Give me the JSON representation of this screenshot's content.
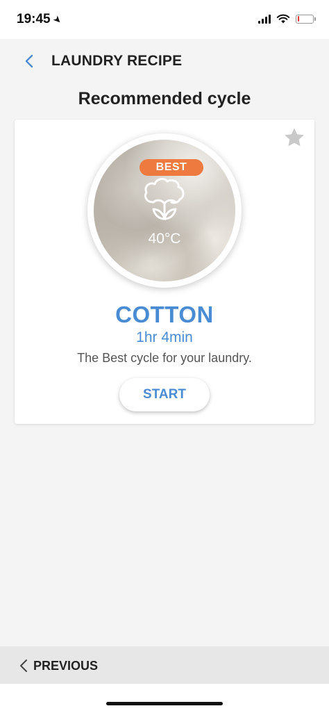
{
  "status_bar": {
    "time": "19:45",
    "battery_level": 0.1,
    "battery_color": "#e03a2f"
  },
  "header": {
    "title": "LAUNDRY RECIPE",
    "back_icon": "chevron-left-icon"
  },
  "section_title": "Recommended cycle",
  "card": {
    "favorite_icon": "star-icon",
    "badge": "BEST",
    "cycle_icon": "cotton-icon",
    "temperature": "40°C",
    "cycle_name": "COTTON",
    "duration": "1hr 4min",
    "description": "The Best cycle for your laundry.",
    "start_label": "START"
  },
  "bottom": {
    "previous_label": "PREVIOUS",
    "previous_icon": "chevron-left-icon"
  },
  "colors": {
    "accent": "#4a8cd3",
    "badge": "#ee7a3f",
    "background": "#f4f4f4"
  }
}
